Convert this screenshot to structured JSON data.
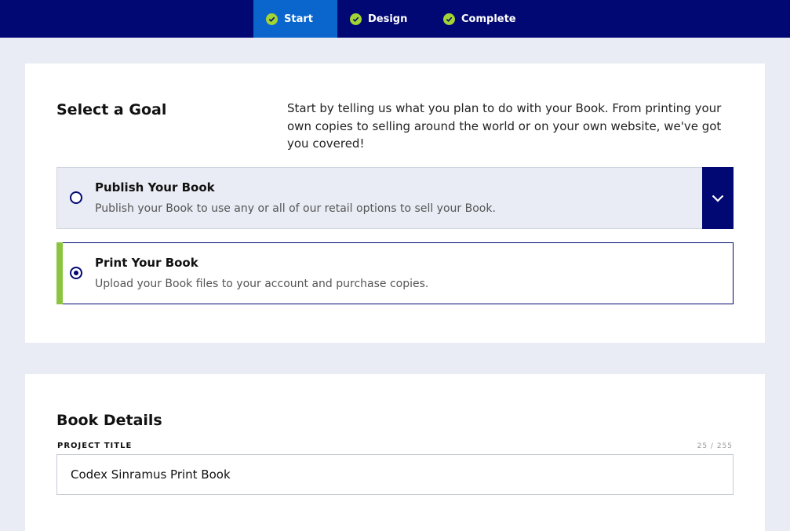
{
  "steps": [
    {
      "label": "Start",
      "active": true
    },
    {
      "label": "Design",
      "active": false
    },
    {
      "label": "Complete",
      "active": false
    }
  ],
  "goal": {
    "title": "Select a Goal",
    "description": "Start by telling us what you plan to do with your Book. From printing your own copies to selling around the world or on your own website, we've got you covered!",
    "options": [
      {
        "title": "Publish Your Book",
        "subtitle": "Publish your Book to use any or all of our retail options to sell your Book.",
        "selected": false
      },
      {
        "title": "Print Your Book",
        "subtitle": "Upload your Book files to your account and purchase copies.",
        "selected": true
      }
    ]
  },
  "details": {
    "title": "Book Details",
    "project_title_label": "PROJECT TITLE",
    "project_title_counter": "25 / 255",
    "project_title_value": "Codex Sinramus Print Book"
  },
  "colors": {
    "nav_bg": "#020873",
    "active_step": "#0a66cc",
    "check": "#a3d434",
    "accent": "#8bc53f",
    "page_bg": "#e9ecf4"
  }
}
